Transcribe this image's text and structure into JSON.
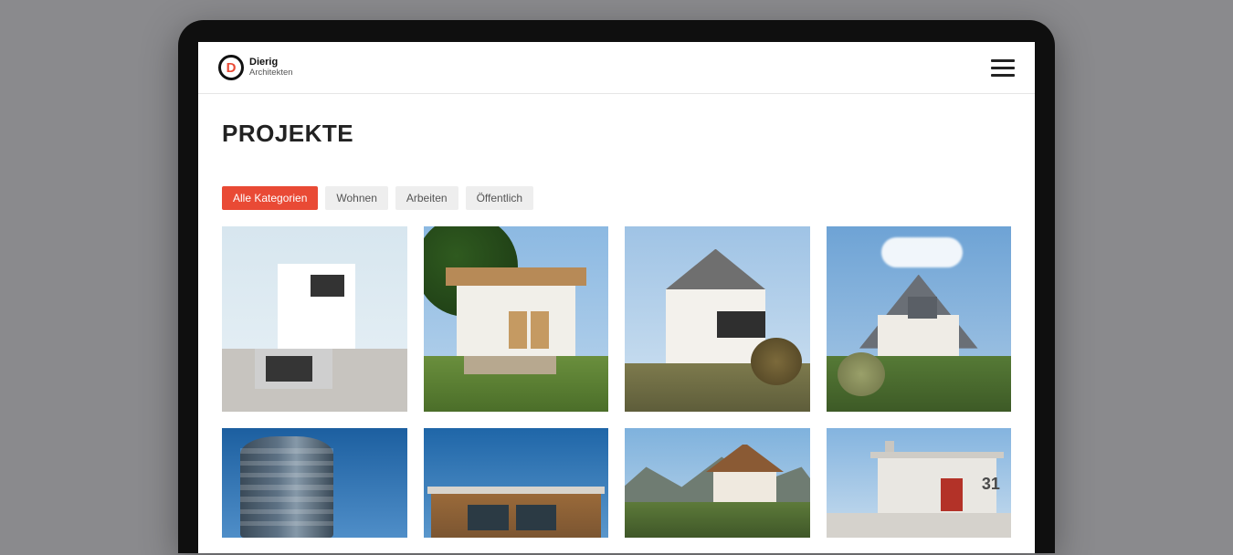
{
  "brand": {
    "letter": "D",
    "name_line1": "Dierig",
    "name_line2": "Architekten"
  },
  "page": {
    "title": "PROJEKTE"
  },
  "filters": [
    {
      "label": "Alle Kategorien",
      "active": true
    },
    {
      "label": "Wohnen",
      "active": false
    },
    {
      "label": "Arbeiten",
      "active": false
    },
    {
      "label": "Öffentlich",
      "active": false
    }
  ],
  "projects_row1": [
    {
      "alt": "Modernes weißes Einfamilienhaus mit Garage"
    },
    {
      "alt": "Landhaus mit Holzläden und Terrasse"
    },
    {
      "alt": "Weißes Haus mit grauem Satteldach und Balkon"
    },
    {
      "alt": "Haus mit steilem grauem Dach und Gaube im Garten"
    }
  ],
  "projects_row2": [
    {
      "alt": "Gebogenes Bürohochhaus"
    },
    {
      "alt": "Flachdach-Holzbau vor blauem Himmel"
    },
    {
      "alt": "Alpines Wohnhaus vor Bergkulisse"
    },
    {
      "alt": "Minimalistischer Eingang mit roter Tür, Hausnummer 31",
      "number": "31"
    }
  ],
  "colors": {
    "accent": "#e94a35",
    "filter_bg": "#eeeeee",
    "text": "#222222"
  }
}
